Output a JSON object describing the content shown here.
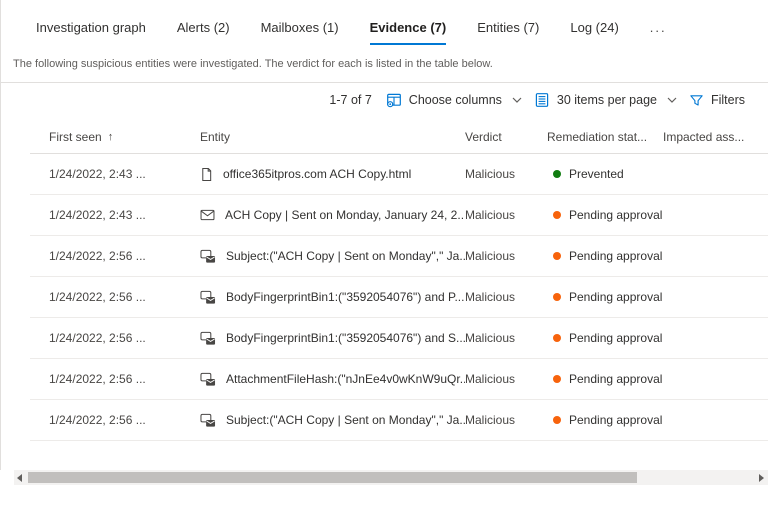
{
  "tabs": [
    {
      "id": "investigation-graph",
      "label": "Investigation graph",
      "active": false
    },
    {
      "id": "alerts",
      "label": "Alerts  (2)",
      "active": false
    },
    {
      "id": "mailboxes",
      "label": "Mailboxes  (1)",
      "active": false
    },
    {
      "id": "evidence",
      "label": "Evidence  (7)",
      "active": true
    },
    {
      "id": "entities",
      "label": "Entities  (7)",
      "active": false
    },
    {
      "id": "log",
      "label": "Log (24)",
      "active": false
    },
    {
      "id": "more",
      "label": "...",
      "active": false
    }
  ],
  "description": "The following suspicious entities were investigated. The verdict for each is listed in the table below.",
  "toolbar": {
    "range": "1-7 of 7",
    "choose_columns": "Choose columns",
    "items_per_page": "30 items per page",
    "filters": "Filters"
  },
  "table": {
    "columns": [
      {
        "label": "First seen",
        "sort": "asc",
        "sort_glyph": "↑"
      },
      {
        "label": "Entity"
      },
      {
        "label": "Verdict"
      },
      {
        "label": "Remediation stat..."
      },
      {
        "label": "Impacted ass..."
      }
    ],
    "rows": [
      {
        "first_seen": "1/24/2022, 2:43 ...",
        "icon": "file",
        "entity": "office365itpros.com ACH Copy.html",
        "verdict": "Malicious",
        "remediation": "Prevented",
        "remediation_color": "#107c10"
      },
      {
        "first_seen": "1/24/2022, 2:43 ...",
        "icon": "mail",
        "entity": "ACH Copy | Sent on Monday, January 24, 2...",
        "verdict": "Malicious",
        "remediation": "Pending approval",
        "remediation_color": "#f7630c"
      },
      {
        "first_seen": "1/24/2022, 2:56 ...",
        "icon": "cluster",
        "entity": "Subject:(\"ACH Copy | Sent on Monday\",\" Ja...",
        "verdict": "Malicious",
        "remediation": "Pending approval",
        "remediation_color": "#f7630c"
      },
      {
        "first_seen": "1/24/2022, 2:56 ...",
        "icon": "cluster",
        "entity": "BodyFingerprintBin1:(\"3592054076\") and P...",
        "verdict": "Malicious",
        "remediation": "Pending approval",
        "remediation_color": "#f7630c"
      },
      {
        "first_seen": "1/24/2022, 2:56 ...",
        "icon": "cluster",
        "entity": "BodyFingerprintBin1:(\"3592054076\") and S...",
        "verdict": "Malicious",
        "remediation": "Pending approval",
        "remediation_color": "#f7630c"
      },
      {
        "first_seen": "1/24/2022, 2:56 ...",
        "icon": "cluster",
        "entity": "AttachmentFileHash:(\"nJnEe4v0wKnW9uQr...",
        "verdict": "Malicious",
        "remediation": "Pending approval",
        "remediation_color": "#f7630c"
      },
      {
        "first_seen": "1/24/2022, 2:56 ...",
        "icon": "cluster",
        "entity": "Subject:(\"ACH Copy | Sent on Monday\",\" Ja...",
        "verdict": "Malicious",
        "remediation": "Pending approval",
        "remediation_color": "#f7630c"
      }
    ]
  },
  "colors": {
    "accent_blue": "#0078d4",
    "prevented_green": "#107c10",
    "pending_orange": "#f7630c",
    "active_tab_underline": "#0078d4"
  }
}
